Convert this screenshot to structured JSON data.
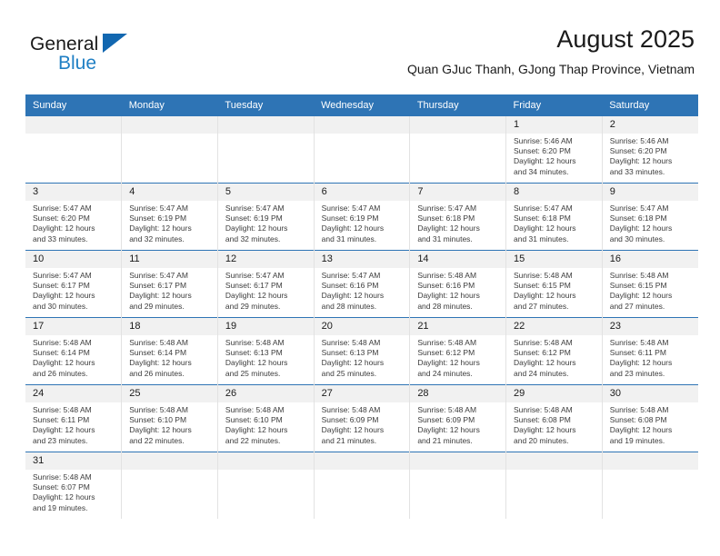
{
  "logo": {
    "word_one": "General",
    "word_two": "Blue",
    "triangle_color": "#1267b0",
    "blue_color": "#1f7fc4"
  },
  "header": {
    "title": "August 2025",
    "subtitle": "Quan GJuc Thanh, GJong Thap Province, Vietnam"
  },
  "theme": {
    "header_blue": "#2E74B5",
    "daynum_bg": "#F1F1F1",
    "divider": "#E2E2E2"
  },
  "weekdays": [
    "Sunday",
    "Monday",
    "Tuesday",
    "Wednesday",
    "Thursday",
    "Friday",
    "Saturday"
  ],
  "weeks": [
    [
      {
        "day": "",
        "blank": true,
        "lines": []
      },
      {
        "day": "",
        "blank": true,
        "lines": []
      },
      {
        "day": "",
        "blank": true,
        "lines": []
      },
      {
        "day": "",
        "blank": true,
        "lines": []
      },
      {
        "day": "",
        "blank": true,
        "lines": []
      },
      {
        "day": "1",
        "lines": [
          "Sunrise: 5:46 AM",
          "Sunset: 6:20 PM",
          "Daylight: 12 hours",
          "and 34 minutes."
        ]
      },
      {
        "day": "2",
        "lines": [
          "Sunrise: 5:46 AM",
          "Sunset: 6:20 PM",
          "Daylight: 12 hours",
          "and 33 minutes."
        ]
      }
    ],
    [
      {
        "day": "3",
        "lines": [
          "Sunrise: 5:47 AM",
          "Sunset: 6:20 PM",
          "Daylight: 12 hours",
          "and 33 minutes."
        ]
      },
      {
        "day": "4",
        "lines": [
          "Sunrise: 5:47 AM",
          "Sunset: 6:19 PM",
          "Daylight: 12 hours",
          "and 32 minutes."
        ]
      },
      {
        "day": "5",
        "lines": [
          "Sunrise: 5:47 AM",
          "Sunset: 6:19 PM",
          "Daylight: 12 hours",
          "and 32 minutes."
        ]
      },
      {
        "day": "6",
        "lines": [
          "Sunrise: 5:47 AM",
          "Sunset: 6:19 PM",
          "Daylight: 12 hours",
          "and 31 minutes."
        ]
      },
      {
        "day": "7",
        "lines": [
          "Sunrise: 5:47 AM",
          "Sunset: 6:18 PM",
          "Daylight: 12 hours",
          "and 31 minutes."
        ]
      },
      {
        "day": "8",
        "lines": [
          "Sunrise: 5:47 AM",
          "Sunset: 6:18 PM",
          "Daylight: 12 hours",
          "and 31 minutes."
        ]
      },
      {
        "day": "9",
        "lines": [
          "Sunrise: 5:47 AM",
          "Sunset: 6:18 PM",
          "Daylight: 12 hours",
          "and 30 minutes."
        ]
      }
    ],
    [
      {
        "day": "10",
        "lines": [
          "Sunrise: 5:47 AM",
          "Sunset: 6:17 PM",
          "Daylight: 12 hours",
          "and 30 minutes."
        ]
      },
      {
        "day": "11",
        "lines": [
          "Sunrise: 5:47 AM",
          "Sunset: 6:17 PM",
          "Daylight: 12 hours",
          "and 29 minutes."
        ]
      },
      {
        "day": "12",
        "lines": [
          "Sunrise: 5:47 AM",
          "Sunset: 6:17 PM",
          "Daylight: 12 hours",
          "and 29 minutes."
        ]
      },
      {
        "day": "13",
        "lines": [
          "Sunrise: 5:47 AM",
          "Sunset: 6:16 PM",
          "Daylight: 12 hours",
          "and 28 minutes."
        ]
      },
      {
        "day": "14",
        "lines": [
          "Sunrise: 5:48 AM",
          "Sunset: 6:16 PM",
          "Daylight: 12 hours",
          "and 28 minutes."
        ]
      },
      {
        "day": "15",
        "lines": [
          "Sunrise: 5:48 AM",
          "Sunset: 6:15 PM",
          "Daylight: 12 hours",
          "and 27 minutes."
        ]
      },
      {
        "day": "16",
        "lines": [
          "Sunrise: 5:48 AM",
          "Sunset: 6:15 PM",
          "Daylight: 12 hours",
          "and 27 minutes."
        ]
      }
    ],
    [
      {
        "day": "17",
        "lines": [
          "Sunrise: 5:48 AM",
          "Sunset: 6:14 PM",
          "Daylight: 12 hours",
          "and 26 minutes."
        ]
      },
      {
        "day": "18",
        "lines": [
          "Sunrise: 5:48 AM",
          "Sunset: 6:14 PM",
          "Daylight: 12 hours",
          "and 26 minutes."
        ]
      },
      {
        "day": "19",
        "lines": [
          "Sunrise: 5:48 AM",
          "Sunset: 6:13 PM",
          "Daylight: 12 hours",
          "and 25 minutes."
        ]
      },
      {
        "day": "20",
        "lines": [
          "Sunrise: 5:48 AM",
          "Sunset: 6:13 PM",
          "Daylight: 12 hours",
          "and 25 minutes."
        ]
      },
      {
        "day": "21",
        "lines": [
          "Sunrise: 5:48 AM",
          "Sunset: 6:12 PM",
          "Daylight: 12 hours",
          "and 24 minutes."
        ]
      },
      {
        "day": "22",
        "lines": [
          "Sunrise: 5:48 AM",
          "Sunset: 6:12 PM",
          "Daylight: 12 hours",
          "and 24 minutes."
        ]
      },
      {
        "day": "23",
        "lines": [
          "Sunrise: 5:48 AM",
          "Sunset: 6:11 PM",
          "Daylight: 12 hours",
          "and 23 minutes."
        ]
      }
    ],
    [
      {
        "day": "24",
        "lines": [
          "Sunrise: 5:48 AM",
          "Sunset: 6:11 PM",
          "Daylight: 12 hours",
          "and 23 minutes."
        ]
      },
      {
        "day": "25",
        "lines": [
          "Sunrise: 5:48 AM",
          "Sunset: 6:10 PM",
          "Daylight: 12 hours",
          "and 22 minutes."
        ]
      },
      {
        "day": "26",
        "lines": [
          "Sunrise: 5:48 AM",
          "Sunset: 6:10 PM",
          "Daylight: 12 hours",
          "and 22 minutes."
        ]
      },
      {
        "day": "27",
        "lines": [
          "Sunrise: 5:48 AM",
          "Sunset: 6:09 PM",
          "Daylight: 12 hours",
          "and 21 minutes."
        ]
      },
      {
        "day": "28",
        "lines": [
          "Sunrise: 5:48 AM",
          "Sunset: 6:09 PM",
          "Daylight: 12 hours",
          "and 21 minutes."
        ]
      },
      {
        "day": "29",
        "lines": [
          "Sunrise: 5:48 AM",
          "Sunset: 6:08 PM",
          "Daylight: 12 hours",
          "and 20 minutes."
        ]
      },
      {
        "day": "30",
        "lines": [
          "Sunrise: 5:48 AM",
          "Sunset: 6:08 PM",
          "Daylight: 12 hours",
          "and 19 minutes."
        ]
      }
    ],
    [
      {
        "day": "31",
        "lines": [
          "Sunrise: 5:48 AM",
          "Sunset: 6:07 PM",
          "Daylight: 12 hours",
          "and 19 minutes."
        ]
      },
      {
        "day": "",
        "blank": true,
        "lines": []
      },
      {
        "day": "",
        "blank": true,
        "lines": []
      },
      {
        "day": "",
        "blank": true,
        "lines": []
      },
      {
        "day": "",
        "blank": true,
        "lines": []
      },
      {
        "day": "",
        "blank": true,
        "lines": []
      },
      {
        "day": "",
        "blank": true,
        "lines": []
      }
    ]
  ]
}
